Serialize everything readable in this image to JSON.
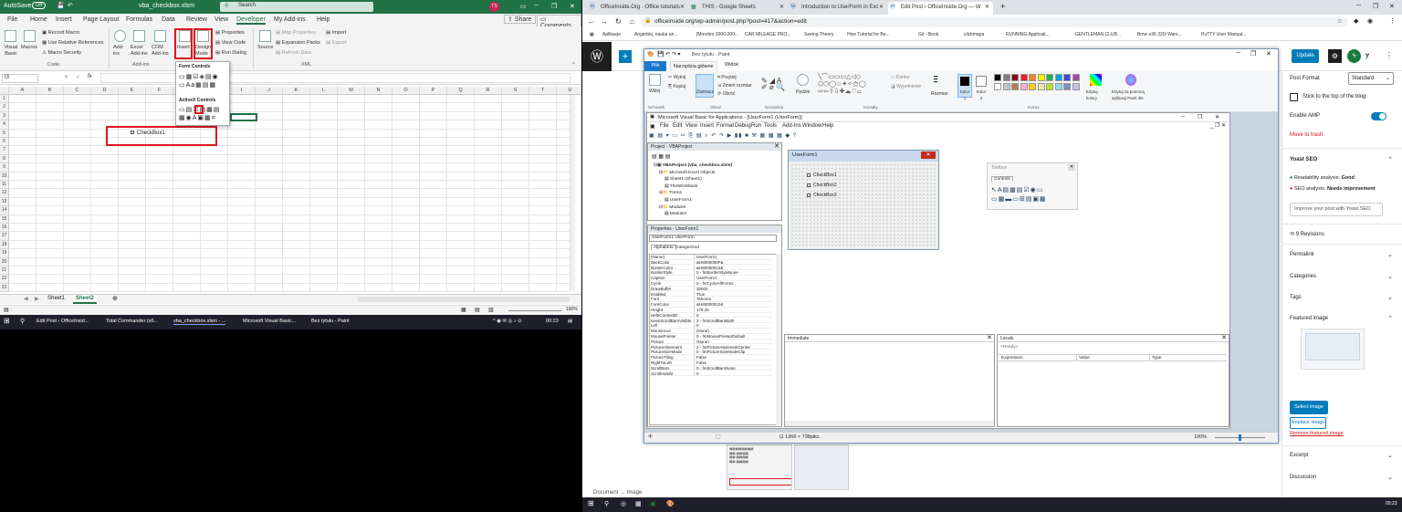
{
  "excel": {
    "autosave": "AutoSave",
    "autosave_state": "Off",
    "filename": "vba_checkbox.xlsm",
    "search_placeholder": "Search",
    "user_initials": "TS",
    "menu": [
      "File",
      "Home",
      "Insert",
      "Page Layout",
      "Formulas",
      "Data",
      "Review",
      "View",
      "Developer",
      "My Add-ins",
      "Help"
    ],
    "share": "Share",
    "comments": "Comments",
    "ribbon": {
      "visual_basic": "Visual Basic",
      "macros": "Macros",
      "record_macro": "Record Macro",
      "use_relative": "Use Relative References",
      "macro_security": "Macro Security",
      "code_group": "Code",
      "add_ins": "Add-ins",
      "excel_add_ins": "Excel Add-ins",
      "com_add_ins": "COM Add-ins",
      "addins_group": "Add-ins",
      "insert": "Insert",
      "design_mode": "Design Mode",
      "properties": "Properties",
      "view_code": "View Code",
      "run_dialog": "Run Dialog",
      "source": "Source",
      "map_properties": "Map Properties",
      "expansion_packs": "Expansion Packs",
      "refresh_data": "Refresh Data",
      "import": "Import",
      "export": "Export",
      "xml_group": "XML"
    },
    "dropdown": {
      "form_controls": "Form Controls",
      "activex_controls": "ActiveX Controls"
    },
    "name_box": "I3",
    "fx": "fx",
    "columns": [
      "A",
      "B",
      "C",
      "D",
      "E",
      "F",
      "G",
      "H",
      "I",
      "J",
      "K",
      "L",
      "M",
      "N",
      "O",
      "P",
      "Q",
      "R",
      "S",
      "T",
      "U"
    ],
    "rows": [
      "1",
      "2",
      "3",
      "4",
      "5",
      "6",
      "7",
      "8",
      "9",
      "10",
      "11",
      "12",
      "13",
      "14",
      "15",
      "16",
      "17",
      "18",
      "19",
      "20",
      "21",
      "22",
      "23"
    ],
    "checkbox_label": "CheckBox1",
    "sheets": [
      "Sheet1",
      "Sheet2"
    ],
    "zoom": "100%"
  },
  "taskbar_left": {
    "items": [
      "Edit Post ‹ OfficeInsid...",
      "Total Commander (x6...",
      "vba_checkbox.xlsm - ...",
      "Microsoft Visual Basic...",
      "Bez tytułu - Paint"
    ],
    "time": "00:23"
  },
  "chrome": {
    "tabs": [
      "OfficeInside.Org - Office tutorials",
      "THIS - Google Sheets",
      "Introduction to UserForm in Exc",
      "Edit Post ‹ OfficeInside.Org — W"
    ],
    "url": "officeinside.org/wp-admin/post.php?post=417&action=edit",
    "bookmarks": [
      "Aplikacje",
      "Angielski, nauka an...",
      "[Mondeo 2000-200...",
      "CAR MILEAGE PRO...",
      "Seeing Theory",
      "Hive Tutorial for Be...",
      "Git - Book",
      "clickmapa",
      "RUNNING Applicati...",
      "GENTLEMAN CLUB...",
      "Bmw e36 320i Wars...",
      "PuTTY User Manual..."
    ]
  },
  "wp": {
    "update": "Update",
    "post_format": "Post Format",
    "post_format_value": "Standard",
    "stick": "Stick to the top of the blog",
    "enable_amp": "Enable AMP",
    "move_trash": "Move to trash",
    "yoast": "Yoast SEO",
    "readability": "Readability analysis:",
    "readability_val": "Good",
    "seo": "SEO analysis:",
    "seo_val": "Needs improvement",
    "improve": "Improve your post with Yoast SEO",
    "revisions": "9 Revisions",
    "permalink": "Permalink",
    "categories": "Categories",
    "tags": "Tags",
    "featured": "Featured image",
    "select_image": "Select image",
    "replace_image": "Replace image",
    "remove_featured": "Remove featured image",
    "excerpt": "Excerpt",
    "discussion": "Discussion",
    "breadcrumb": "Document → Image"
  },
  "paint": {
    "title": "Bez tytułu - Paint",
    "tab_file": "Plik",
    "tab_home": "Narzędzia główne",
    "tab_view": "Widok",
    "paste": "Wklej",
    "cut": "Wytnij",
    "copy": "Kopiuj",
    "select": "Zaznacz",
    "crop": "Przytnij",
    "resize": "Zmień rozmiar",
    "rotate": "Obróć",
    "brushes": "Pędzle",
    "outline": "Kontur",
    "fill": "Wypełnienie",
    "size": "Rozmiar",
    "color1": "Kolor 1",
    "color2": "Kolor 2",
    "edit_colors": "Edytuj kolory",
    "paint3d": "Edytuj za pomocą aplikacji Paint 3D",
    "groups": [
      "Schowek",
      "Obraz",
      "Narzędzia",
      "Kształty",
      "Kolory"
    ],
    "status_size": "1366 × 738pikс.",
    "zoom": "100%",
    "palette": [
      "#000000",
      "#7f7f7f",
      "#880015",
      "#ed1c24",
      "#ff7f27",
      "#fff200",
      "#22b14c",
      "#00a2e8",
      "#3f48cc",
      "#a349a4",
      "#ffffff",
      "#c3c3c3",
      "#b97a57",
      "#ffaec9",
      "#ffc90e",
      "#efe4b0",
      "#b5e61d",
      "#99d9ea",
      "#7092be",
      "#c8bfe7"
    ]
  },
  "vba": {
    "title": "Microsoft Visual Basic for Applications - [UserForm1 (UserForm)]",
    "menu": [
      "File",
      "Edit",
      "View",
      "Insert",
      "Format",
      "Debug",
      "Run",
      "Tools",
      "Add-Ins",
      "Window",
      "Help"
    ],
    "project_title": "Project - VBAProject",
    "tree": [
      "VBAProject (vba_checkbox.xlsm)",
      "Microsoft Excel Objects",
      "Sheet1 (Sheet1)",
      "ThisWorkbook",
      "Forms",
      "UserForm1",
      "Modules",
      "Module1"
    ],
    "props_title": "Properties - UserForm1",
    "props_object": "UserForm1 UserForm",
    "props_tabs": [
      "Alphabetic",
      "Categorized"
    ],
    "props": [
      [
        "(Name)",
        "UserForm1"
      ],
      [
        "BackColor",
        "&H8000000F&"
      ],
      [
        "BorderColor",
        "&H80000012&"
      ],
      [
        "BorderStyle",
        "0 - fmBorderStyleNone"
      ],
      [
        "Caption",
        "UserForm1"
      ],
      [
        "Cycle",
        "0 - fmCycleAllForms"
      ],
      [
        "DrawBuffer",
        "32000"
      ],
      [
        "Enabled",
        "True"
      ],
      [
        "Font",
        "Tahoma"
      ],
      [
        "ForeColor",
        "&H80000012&"
      ],
      [
        "Height",
        "179,25"
      ],
      [
        "HelpContextID",
        "0"
      ],
      [
        "KeepScrollBarsVisible",
        "3 - fmScrollBarsBoth"
      ],
      [
        "Left",
        "0"
      ],
      [
        "MouseIcon",
        "(None)"
      ],
      [
        "MousePointer",
        "0 - fmMousePointerDefault"
      ],
      [
        "Picture",
        "(None)"
      ],
      [
        "PictureAlignment",
        "2 - fmPictureAlignmentCenter"
      ],
      [
        "PictureSizeMode",
        "0 - fmPictureSizeModeClip"
      ],
      [
        "PictureTiling",
        "False"
      ],
      [
        "RightToLeft",
        "False"
      ],
      [
        "ScrollBars",
        "0 - fmScrollBarsNone"
      ],
      [
        "ScrollHeight",
        "0"
      ]
    ],
    "userform_title": "UserForm1",
    "checkboxes": [
      "CheckBox1",
      "CheckBox2",
      "CheckBox3"
    ],
    "toolbox_title": "Toolbox",
    "toolbox_tab": "Controls",
    "immediate": "Immediate",
    "locals": "Locals",
    "locals_ready": "<Ready>",
    "locals_cols": [
      "Expression",
      "Value",
      "Type"
    ]
  },
  "taskbar_right": {
    "time": "00:23"
  }
}
